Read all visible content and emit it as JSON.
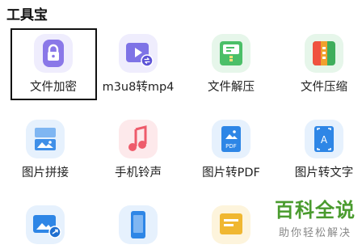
{
  "section": {
    "title": "工具宝"
  },
  "tools": [
    {
      "label": "文件加密",
      "icon": "lock-icon",
      "color": "#8a78e8"
    },
    {
      "label": "m3u8转mp4",
      "icon": "video-convert-icon",
      "color": "#7e73e6"
    },
    {
      "label": "文件解压",
      "icon": "unzip-icon",
      "color": "#4bbf68"
    },
    {
      "label": "文件压缩",
      "icon": "compress-icon",
      "color": "#f0a12e"
    },
    {
      "label": "图片拼接",
      "icon": "image-stitch-icon",
      "color": "#3f8fe8"
    },
    {
      "label": "手机铃声",
      "icon": "music-note-icon",
      "color": "#ee5b6b"
    },
    {
      "label": "图片转PDF",
      "icon": "image-pdf-icon",
      "color": "#2e86e6"
    },
    {
      "label": "图片转文字",
      "icon": "image-text-icon",
      "color": "#2e86e6"
    },
    {
      "label": "",
      "icon": "image-share-icon",
      "color": "#2e86e6"
    },
    {
      "label": "",
      "icon": "phone-icon",
      "color": "#2e86e6"
    },
    {
      "label": "",
      "icon": "document-icon",
      "color": "#f0b731"
    }
  ],
  "watermark": {
    "title": "百科全说",
    "subtitle": "助你轻松解决"
  }
}
